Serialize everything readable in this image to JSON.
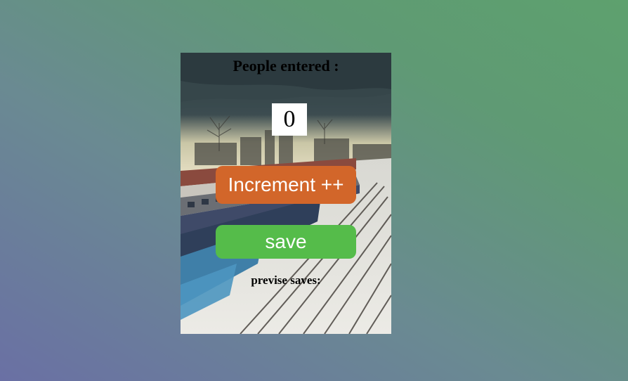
{
  "counter_widget": {
    "title": "People entered :",
    "count": "0",
    "increment_label": "Increment ++",
    "save_label": "save",
    "previous_saves_label": "previse saves:"
  },
  "colors": {
    "increment_button": "#d2662a",
    "save_button": "#55bc4a",
    "counter_box": "#ffffff"
  }
}
